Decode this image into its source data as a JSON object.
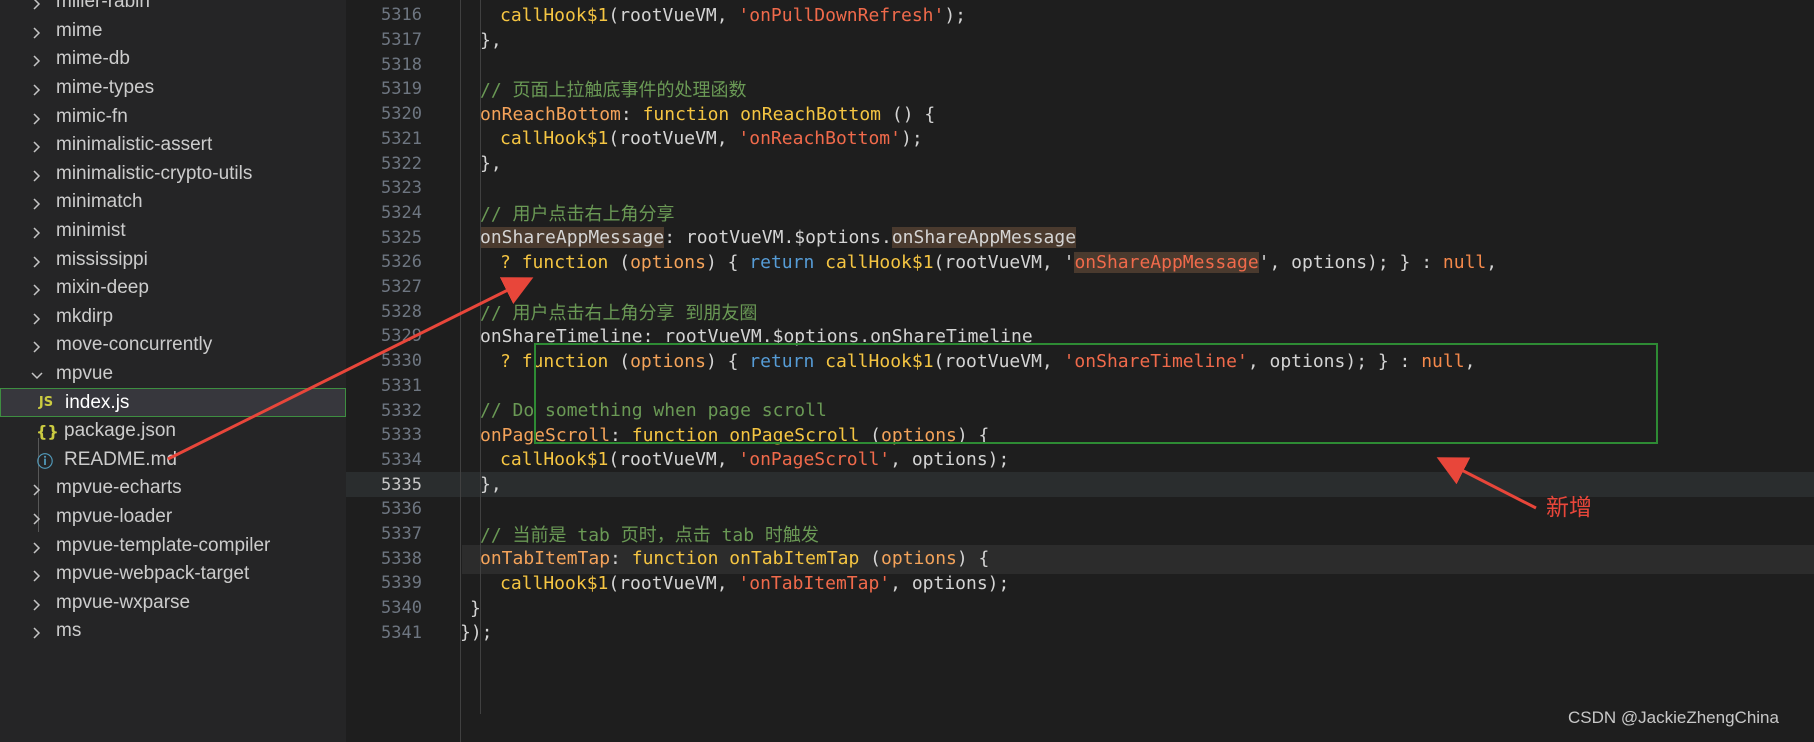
{
  "sidebar": {
    "items": [
      {
        "label": "miller-rabin",
        "type": "folder"
      },
      {
        "label": "mime",
        "type": "folder"
      },
      {
        "label": "mime-db",
        "type": "folder"
      },
      {
        "label": "mime-types",
        "type": "folder"
      },
      {
        "label": "mimic-fn",
        "type": "folder"
      },
      {
        "label": "minimalistic-assert",
        "type": "folder"
      },
      {
        "label": "minimalistic-crypto-utils",
        "type": "folder"
      },
      {
        "label": "minimatch",
        "type": "folder"
      },
      {
        "label": "minimist",
        "type": "folder"
      },
      {
        "label": "mississippi",
        "type": "folder"
      },
      {
        "label": "mixin-deep",
        "type": "folder"
      },
      {
        "label": "mkdirp",
        "type": "folder"
      },
      {
        "label": "move-concurrently",
        "type": "folder"
      },
      {
        "label": "mpvue",
        "type": "folder-open"
      },
      {
        "label": "index.js",
        "type": "file-js",
        "icon": "JS"
      },
      {
        "label": "package.json",
        "type": "file-json",
        "icon": "{}"
      },
      {
        "label": "README.md",
        "type": "file-info",
        "icon": "ⓘ"
      },
      {
        "label": "mpvue-echarts",
        "type": "folder"
      },
      {
        "label": "mpvue-loader",
        "type": "folder"
      },
      {
        "label": "mpvue-template-compiler",
        "type": "folder"
      },
      {
        "label": "mpvue-webpack-target",
        "type": "folder"
      },
      {
        "label": "mpvue-wxparse",
        "type": "folder"
      },
      {
        "label": "ms",
        "type": "folder"
      }
    ]
  },
  "editor": {
    "line_numbers": [
      "5316",
      "5317",
      "5318",
      "5319",
      "5320",
      "5321",
      "5322",
      "5323",
      "5324",
      "5325",
      "5326",
      "5327",
      "5328",
      "5329",
      "5330",
      "5331",
      "5332",
      "5333",
      "5334",
      "5335",
      "5336",
      "5337",
      "5338",
      "5339",
      "5340",
      "5341"
    ],
    "active_line": "5335",
    "code": {
      "l5316": [
        "callHook$1",
        "(rootVueVM, ",
        "'onPullDownRefresh'",
        ");"
      ],
      "l5317": "},",
      "l5319": "// 页面上拉触底事件的处理函数",
      "l5320": [
        "onReachBottom",
        ": ",
        "function",
        " ",
        "onReachBottom",
        " () {"
      ],
      "l5321": [
        "callHook$1",
        "(rootVueVM, ",
        "'onReachBottom'",
        ");"
      ],
      "l5322": "},",
      "l5324": "// 用户点击右上角分享",
      "l5325": [
        "onShareAppMessage",
        ": rootVueVM.$options.",
        "onShareAppMessage"
      ],
      "l5326": [
        "? ",
        "function",
        " (",
        "options",
        ") { ",
        "return",
        " ",
        "callHook$1",
        "(rootVueVM, '",
        "onShareAppMessage",
        "', options); } : ",
        "null",
        ","
      ],
      "l5328": "// 用户点击右上角分享 到朋友圈",
      "l5329": [
        "onShareTimeline",
        ": rootVueVM.$options.onShareTimeline"
      ],
      "l5330": [
        "? ",
        "function",
        " (",
        "options",
        ") { ",
        "return",
        " ",
        "callHook$1",
        "(rootVueVM, ",
        "'onShareTimeline'",
        ", options); } : ",
        "null",
        ","
      ],
      "l5332": "// Do something when page scroll",
      "l5333": [
        "onPageScroll",
        ": ",
        "function",
        " ",
        "onPageScroll",
        " (",
        "options",
        ") {"
      ],
      "l5334": [
        "callHook$1",
        "(rootVueVM, ",
        "'onPageScroll'",
        ", options);"
      ],
      "l5335": "},",
      "l5337a": "// 当前是 ",
      "l5337b": "tab",
      "l5337c": " 页时，点击 ",
      "l5337d": "tab",
      "l5337e": " 时触发",
      "l5338": [
        "onTabItemTap",
        ": ",
        "function",
        " ",
        "onTabItemTap",
        " (",
        "options",
        ") {"
      ],
      "l5339": [
        "callHook$1",
        "(rootVueVM, ",
        "'onTabItemTap'",
        ", options);"
      ],
      "l5340": "}",
      "l5341": "});"
    }
  },
  "annotation": {
    "label": "新增",
    "color": "#e8463a",
    "box_color": "#2e8b34"
  },
  "watermark": "CSDN @JackieZhengChina"
}
